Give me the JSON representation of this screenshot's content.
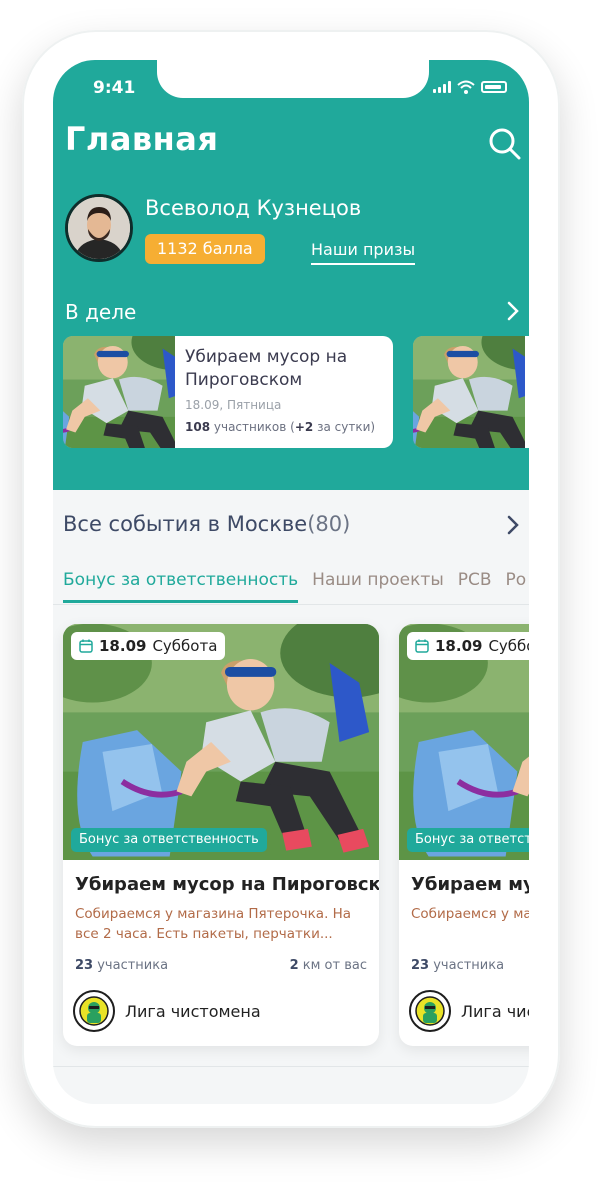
{
  "status_bar": {
    "time": "9:41"
  },
  "header": {
    "title": "Главная"
  },
  "user": {
    "name": "Всеволод Кузнецов",
    "points": "1132 балла",
    "prizes_link": "Наши призы"
  },
  "in_work": {
    "title": "В деле",
    "cards": [
      {
        "title": "Убираем мусор на Пироговском",
        "date": "18.09, Пятница",
        "participants": "108",
        "participants_label": "участников",
        "delta_prefix": "(",
        "delta": "+2",
        "delta_suffix": "за сутки)"
      }
    ]
  },
  "events": {
    "title": "Все события в Москве",
    "count": "(80)",
    "tabs": [
      "Бонус за ответственность",
      "Наши проекты",
      "РСВ",
      "Ро"
    ],
    "cards": [
      {
        "date": "18.09",
        "weekday": "Суббота",
        "tag": "Бонус за ответственность",
        "title": "Убираем мусор на Пироговском",
        "description": "Собираемся у магазина Пятерочка. На все 2 часа. Есть пакеты, перчатки...",
        "participants": "23",
        "participants_label": "участника",
        "distance": "2",
        "distance_label": "км от вас",
        "organizer": "Лига чистомена"
      },
      {
        "date": "18.09",
        "weekday": "Суббот",
        "tag": "Бонус за ответственность",
        "title": "Убираем мусо",
        "description": "Собираемся у мага часа. Есть пакеты,",
        "participants": "23",
        "participants_label": "участника",
        "organizer": "Лига чист"
      }
    ]
  },
  "colors": {
    "accent": "#20a99b",
    "points_badge": "#f6ae33",
    "title_dark": "#3e4a66",
    "description": "#b26b48"
  }
}
